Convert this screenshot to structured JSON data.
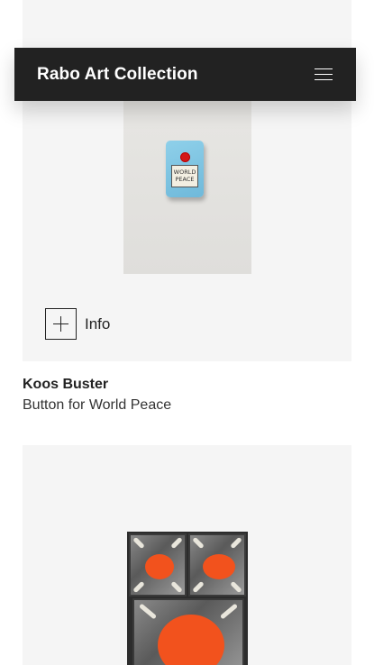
{
  "header": {
    "brand": "Rabo Art Collection",
    "menu_icon": "hamburger-menu-icon"
  },
  "artworks": [
    {
      "info_label": "Info",
      "info_icon": "plus-icon",
      "artist": "Koos Buster",
      "title": "Button for World Peace",
      "label_text": "WORLD PEACE"
    },
    {}
  ],
  "colors": {
    "header_bg": "#222222",
    "card_bg": "#f5f5f5",
    "accent_orange": "#f2521d"
  }
}
